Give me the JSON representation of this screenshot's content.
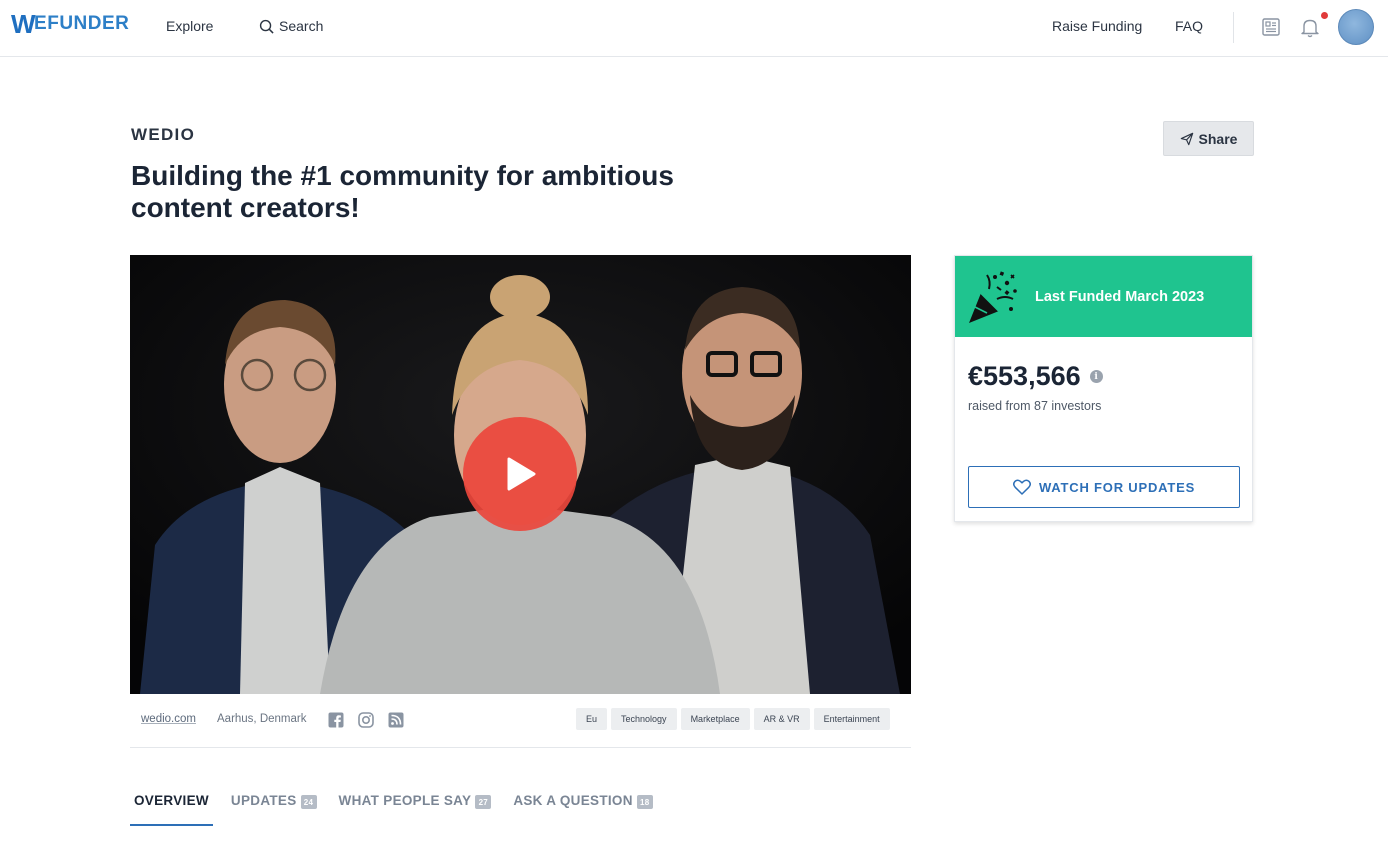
{
  "nav": {
    "logo": "EFUNDER",
    "logo_initial": "W",
    "explore": "Explore",
    "search": "Search",
    "raise_funding": "Raise Funding",
    "faq": "FAQ",
    "icons": [
      "search-icon",
      "newspaper-icon",
      "bell-icon"
    ],
    "notification_color": "#e03a3a"
  },
  "header": {
    "company": "WEDIO",
    "tagline": "Building the #1 community for ambitious content creators!",
    "share_label": "Share"
  },
  "meta": {
    "website": "wedio.com",
    "location": "Aarhus, Denmark",
    "social_icons": [
      "facebook-icon",
      "instagram-icon",
      "rss-icon"
    ],
    "tags": [
      "Eu",
      "Technology",
      "Marketplace",
      "AR & VR",
      "Entertainment"
    ]
  },
  "tabs": [
    {
      "label": "OVERVIEW",
      "count": null,
      "active": true
    },
    {
      "label": "UPDATES",
      "count": "24",
      "active": false
    },
    {
      "label": "WHAT PEOPLE SAY",
      "count": "27",
      "active": false
    },
    {
      "label": "ASK A QUESTION",
      "count": "18",
      "active": false
    }
  ],
  "funding": {
    "banner": "Last Funded March 2023",
    "amount": "€553,566",
    "raised_text": "raised from 87 investors",
    "watch_label": "WATCH FOR UPDATES",
    "banner_color": "#1fc48f",
    "accent_color": "#2d6fb7"
  },
  "video": {
    "play_color": "#eb463c"
  }
}
